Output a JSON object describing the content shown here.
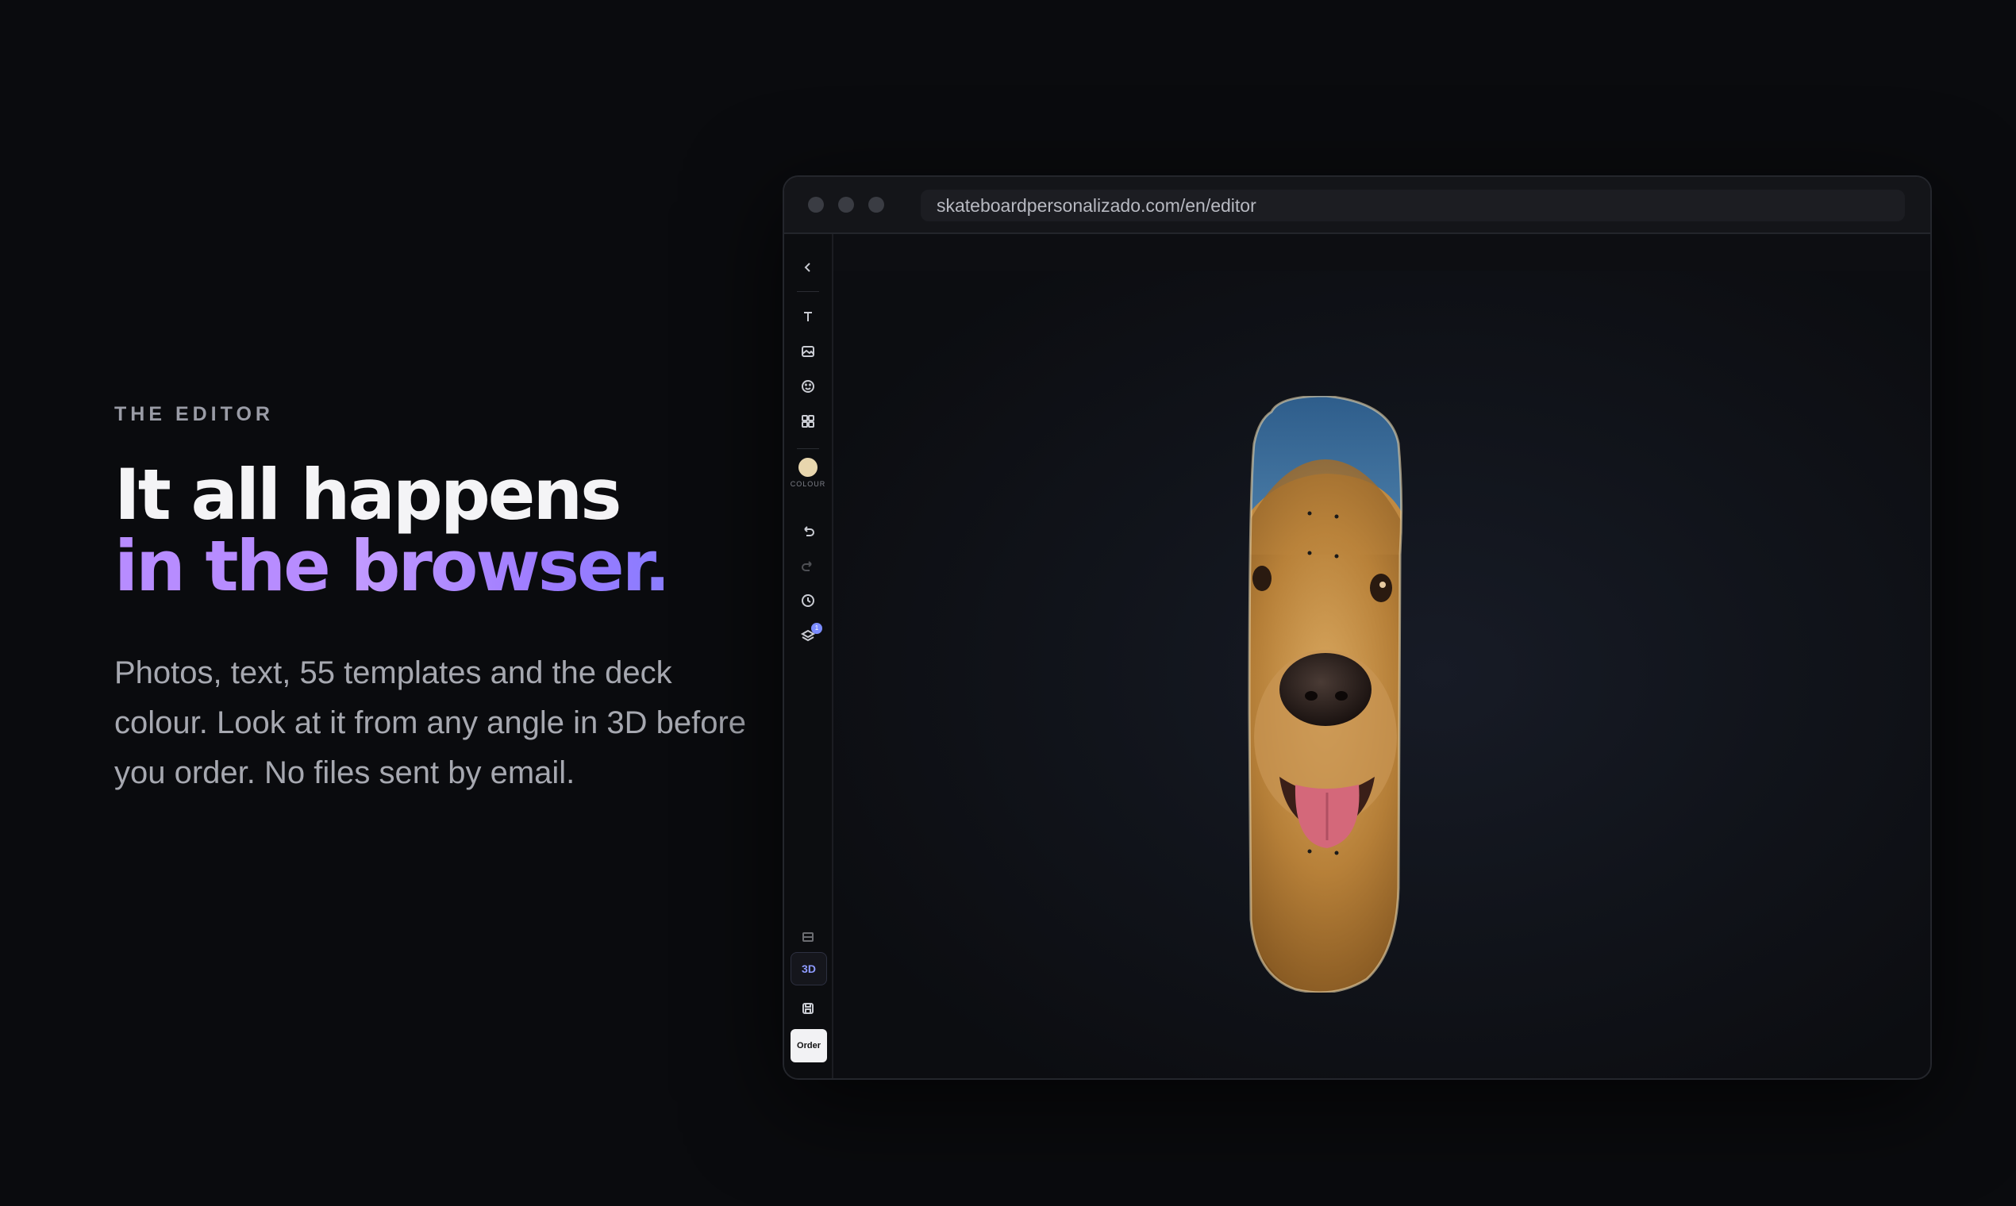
{
  "hero": {
    "eyebrow": "THE EDITOR",
    "headline_line1": "It all happens",
    "headline_line2_prefix": "in the ",
    "headline_line2_highlight": "browser.",
    "body": "Photos, text, 55 templates and the deck colour. Look at it from any angle in 3D before you order. No files sent by email."
  },
  "browser": {
    "url": "skateboardpersonalizado.com/en/editor"
  },
  "sidebar": {
    "colour_label": "COLOUR",
    "layers_badge": "1",
    "view_3d_label": "3D",
    "order_label": "Order"
  },
  "canvas": {
    "more_label": "···"
  },
  "colors": {
    "background": "#0a0b0e",
    "accent_purple": "#b78cff",
    "accent_blue": "#8e9bff",
    "deck_colour": "#e8d6ae"
  }
}
